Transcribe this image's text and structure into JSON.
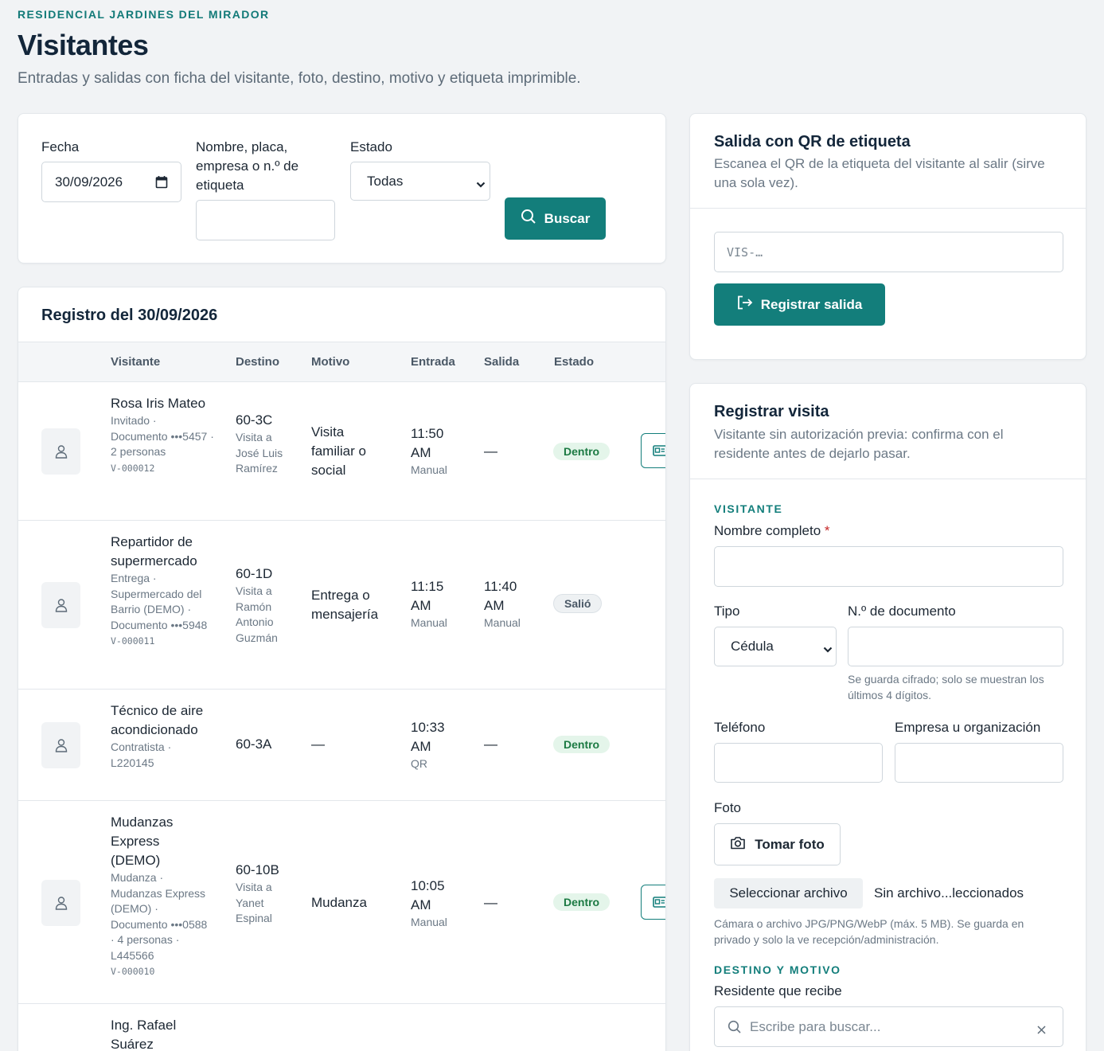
{
  "header": {
    "eyebrow": "RESIDENCIAL JARDINES DEL MIRADOR",
    "title": "Visitantes",
    "subtitle": "Entradas y salidas con ficha del visitante, foto, destino, motivo y etiqueta imprimible."
  },
  "filters": {
    "date_label": "Fecha",
    "date_value": "30/09/2026",
    "search_label": "Nombre, placa, empresa o n.º de etiqueta",
    "search_value": "",
    "status_label": "Estado",
    "status_value": "Todas",
    "search_button": "Buscar"
  },
  "log": {
    "title": "Registro del 30/09/2026",
    "columns": [
      "Visitante",
      "Destino",
      "Motivo",
      "Entrada",
      "Salida",
      "Estado"
    ],
    "rows": [
      {
        "name": "Rosa Iris Mateo",
        "details": "Invitado · Documento •••5457 · 2 personas",
        "code": "V-000012",
        "unit": "60-3C",
        "host": "Visita a José Luis Ramírez",
        "reason": "Visita familiar o social",
        "entry_time": "11:50 AM",
        "entry_method": "Manual",
        "exit_time": "—",
        "exit_method": "",
        "status": "Dentro"
      },
      {
        "name": "Repartidor de supermercado",
        "details": "Entrega · Supermercado del Barrio (DEMO) · Documento •••5948",
        "code": "V-000011",
        "unit": "60-1D",
        "host": "Visita a Ramón Antonio Guzmán",
        "reason": "Entrega o mensajería",
        "entry_time": "11:15 AM",
        "entry_method": "Manual",
        "exit_time": "11:40 AM",
        "exit_method": "Manual",
        "status": "Salió"
      },
      {
        "name": "Técnico de aire acondicionado",
        "details": "Contratista · L220145",
        "code": "",
        "unit": "60-3A",
        "host": "",
        "reason": "—",
        "entry_time": "10:33 AM",
        "entry_method": "QR",
        "exit_time": "—",
        "exit_method": "",
        "status": "Dentro"
      },
      {
        "name": "Mudanzas Express (DEMO)",
        "details": "Mudanza · Mudanzas Express (DEMO) · Documento •••0588 · 4 personas · L445566",
        "code": "V-000010",
        "unit": "60-10B",
        "host": "Visita a Yanet Espinal",
        "reason": "Mudanza",
        "entry_time": "10:05 AM",
        "entry_method": "Manual",
        "exit_time": "—",
        "exit_method": "",
        "status": "Dentro"
      },
      {
        "name": "Ing. Rafael Suárez"
      }
    ]
  },
  "qr_exit": {
    "title": "Salida con QR de etiqueta",
    "description": "Escanea el QR de la etiqueta del visitante al salir (sirve una sola vez).",
    "input_placeholder": "VIS-…",
    "button": "Registrar salida"
  },
  "register": {
    "title": "Registrar visita",
    "description": "Visitante sin autorización previa: confirma con el residente antes de dejarlo pasar.",
    "visitor_section": "VISITANTE",
    "full_name_label": "Nombre completo",
    "required_mark": "*",
    "type_label": "Tipo",
    "type_value": "Cédula",
    "doc_label": "N.º de documento",
    "doc_hint": "Se guarda cifrado; solo se muestran los últimos 4 dígitos.",
    "phone_label": "Teléfono",
    "company_label": "Empresa u organización",
    "photo_label": "Foto",
    "take_photo_button": "Tomar foto",
    "select_file_button": "Seleccionar archivo",
    "no_file_text": "Sin archivo...leccionados",
    "photo_hint": "Cámara o archivo JPG/PNG/WebP (máx. 5 MB). Se guarda en privado y solo la ve recepción/administración.",
    "destination_section": "DESTINO Y MOTIVO",
    "resident_label": "Residente que recibe",
    "resident_placeholder": "Escribe para buscar..."
  },
  "colors": {
    "accent": "#137e7b",
    "title": "#13263a",
    "badge_in_bg": "#e4f5ea",
    "badge_in_text": "#1c7a43"
  }
}
